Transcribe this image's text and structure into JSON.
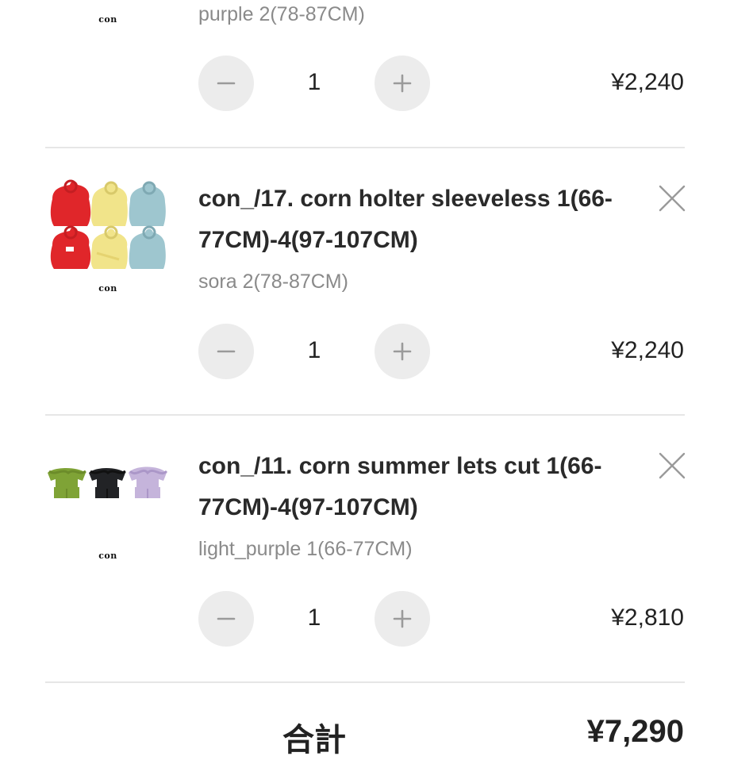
{
  "cart": {
    "items": [
      {
        "brand": "con",
        "title": "",
        "variant": "purple 2(78-87CM)",
        "quantity": "1",
        "price": "¥2,240",
        "thumbnail": "icon-of-garments-purple"
      },
      {
        "brand": "con",
        "title_line1": "con_/17. corn holter sleeveless 1(66-",
        "title_line2": "77CM)-4(97-107CM)",
        "variant": "sora 2(78-87CM)",
        "quantity": "1",
        "price": "¥2,240",
        "thumbnail": "halter-tops-red-yellow-blue"
      },
      {
        "brand": "con",
        "title_line1": "con_/11. corn summer lets cut 1(66-",
        "title_line2": "77CM)-4(97-107CM)",
        "variant": "light_purple 1(66-77CM)",
        "quantity": "1",
        "price": "¥2,810",
        "thumbnail": "ruffle-tops-green-black-lavender"
      }
    ],
    "footer": {
      "label": "合計",
      "value": "¥7,290"
    }
  },
  "icons": {
    "minus": "minus-icon",
    "plus": "plus-icon",
    "remove": "close-icon"
  },
  "colors": {
    "stepper_bg": "#ececec",
    "divider": "#e6e6e6",
    "variant_text": "#8a8a8a",
    "icon": "#9a9a9a"
  }
}
